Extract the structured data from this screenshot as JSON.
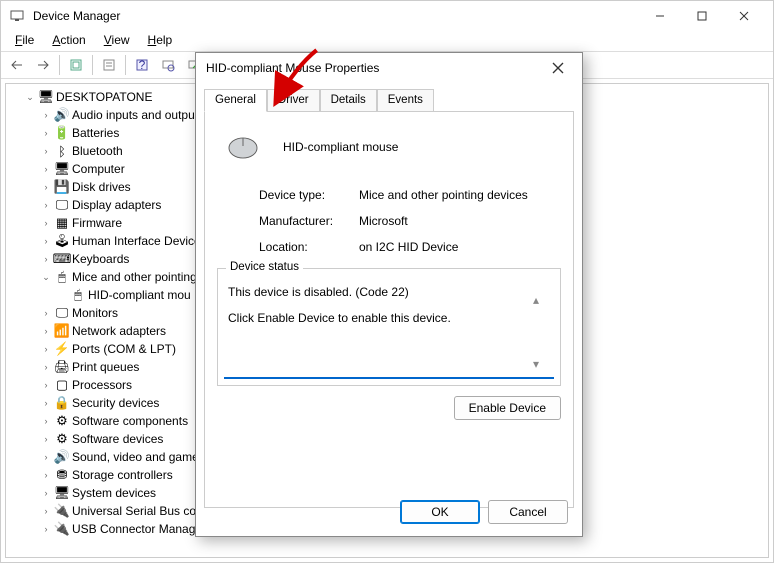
{
  "window": {
    "title": "Device Manager"
  },
  "menubar": [
    "File",
    "Action",
    "View",
    "Help"
  ],
  "menubar_hotkey_idx": [
    0,
    0,
    0,
    0
  ],
  "tree": {
    "root": "DESKTOPATONE",
    "nodes": [
      {
        "label": "Audio inputs and outpu",
        "expanded": false
      },
      {
        "label": "Batteries",
        "expanded": false
      },
      {
        "label": "Bluetooth",
        "expanded": false
      },
      {
        "label": "Computer",
        "expanded": false
      },
      {
        "label": "Disk drives",
        "expanded": false
      },
      {
        "label": "Display adapters",
        "expanded": false
      },
      {
        "label": "Firmware",
        "expanded": false
      },
      {
        "label": "Human Interface Device",
        "expanded": false
      },
      {
        "label": "Keyboards",
        "expanded": false
      },
      {
        "label": "Mice and other pointing",
        "expanded": true,
        "children": [
          {
            "label": "HID-compliant mou"
          }
        ]
      },
      {
        "label": "Monitors",
        "expanded": false
      },
      {
        "label": "Network adapters",
        "expanded": false
      },
      {
        "label": "Ports (COM & LPT)",
        "expanded": false
      },
      {
        "label": "Print queues",
        "expanded": false
      },
      {
        "label": "Processors",
        "expanded": false
      },
      {
        "label": "Security devices",
        "expanded": false
      },
      {
        "label": "Software components",
        "expanded": false
      },
      {
        "label": "Software devices",
        "expanded": false
      },
      {
        "label": "Sound, video and game",
        "expanded": false
      },
      {
        "label": "Storage controllers",
        "expanded": false
      },
      {
        "label": "System devices",
        "expanded": false
      },
      {
        "label": "Universal Serial Bus cont.",
        "expanded": false
      },
      {
        "label": "USB Connector Managers",
        "expanded": false
      }
    ]
  },
  "icons": [
    "🔊",
    "🔋",
    "ᛒ",
    "🖥",
    "💾",
    "🖵",
    "▦",
    "🕹",
    "⌨",
    "🖱",
    "🖵",
    "📶",
    "⚡",
    "🖨",
    "▢",
    "🔒",
    "⚙",
    "⚙",
    "🔊",
    "⛃",
    "🖥",
    "🔌",
    "🔌"
  ],
  "dialog": {
    "title": "HID-compliant Mouse Properties",
    "tabs": [
      "General",
      "Driver",
      "Details",
      "Events"
    ],
    "active_tab": 0,
    "device_name": "HID-compliant mouse",
    "info": {
      "type_label": "Device type:",
      "type_value": "Mice and other pointing devices",
      "mfr_label": "Manufacturer:",
      "mfr_value": "Microsoft",
      "loc_label": "Location:",
      "loc_value": "on I2C HID Device"
    },
    "status": {
      "legend": "Device status",
      "line1": "This device is disabled. (Code 22)",
      "line2": "Click Enable Device to enable this device."
    },
    "buttons": {
      "enable": "Enable Device",
      "ok": "OK",
      "cancel": "Cancel"
    }
  }
}
